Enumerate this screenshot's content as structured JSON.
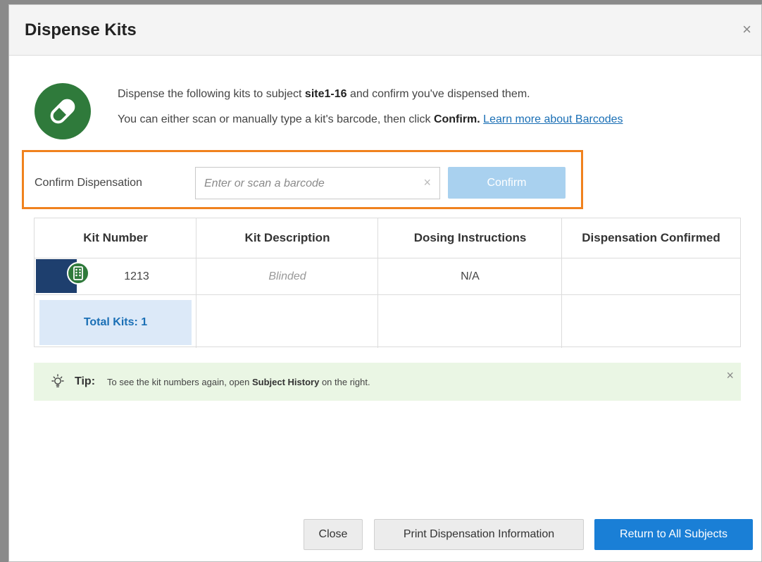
{
  "dialog": {
    "title": "Dispense Kits",
    "close_glyph": "×"
  },
  "intro": {
    "line1_pre": "Dispense the following kits to subject ",
    "subject_id": "site1-16",
    "line1_post": " and confirm you've dispensed them.",
    "line2_pre": "You can either scan or manually type a kit's barcode, then click ",
    "line2_bold": "Confirm.",
    "learn_more_link": "Learn more about Barcodes"
  },
  "confirm": {
    "label": "Confirm Dispensation",
    "placeholder": "Enter or scan a barcode",
    "clear_glyph": "×",
    "button_label": "Confirm"
  },
  "table": {
    "headers": [
      "Kit Number",
      "Kit Description",
      "Dosing Instructions",
      "Dispensation Confirmed"
    ],
    "rows": [
      {
        "kit_number": "1213",
        "kit_description": "Blinded",
        "dosing": "N/A",
        "confirmed": ""
      }
    ],
    "total_kits": "Total Kits: 1"
  },
  "tip": {
    "label": "Tip:",
    "text_pre": "To see the kit numbers again, open ",
    "text_bold": "Subject History",
    "text_post": " on the right.",
    "close_glyph": "×"
  },
  "footer": {
    "close_label": "Close",
    "print_label": "Print Dispensation Information",
    "return_label": "Return to All Subjects"
  },
  "colors": {
    "accent_blue": "#1a7fd6",
    "highlight_orange": "#f0821e",
    "icon_green": "#2f7a3b",
    "kit_stripe_navy": "#1e3f6e",
    "tip_background": "#eaf6e4"
  },
  "icons": {
    "medication": "pill-icon",
    "kit": "kit-box-icon",
    "tip": "lightbulb-icon"
  }
}
